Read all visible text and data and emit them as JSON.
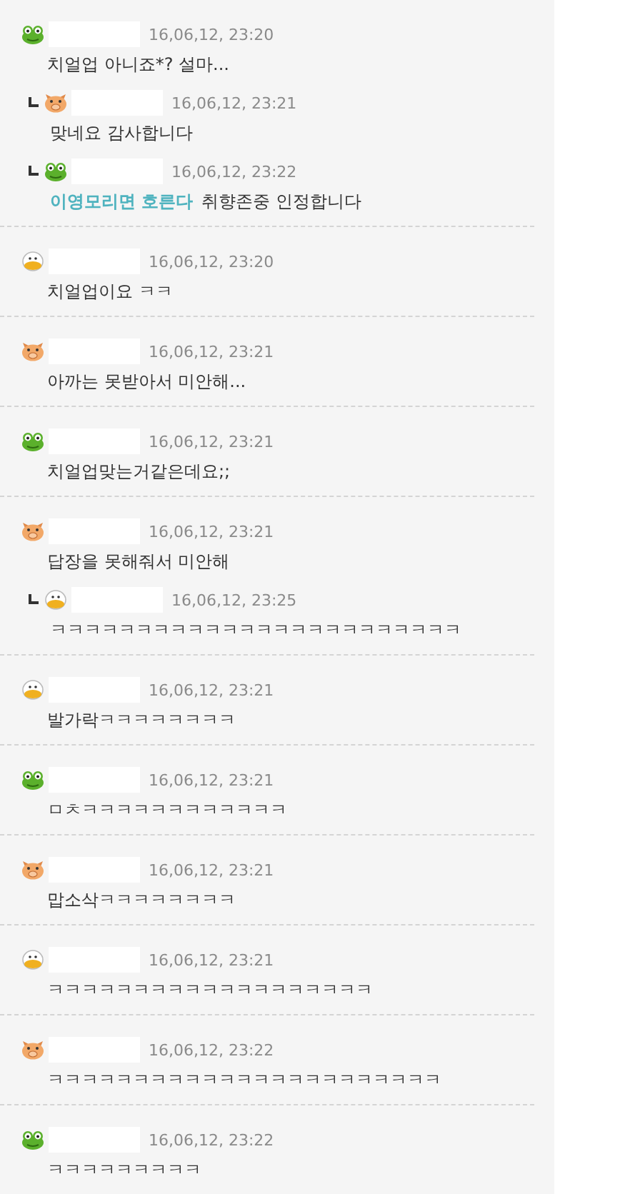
{
  "comments": [
    {
      "kind": "frog",
      "date": "16,06,12, 23:20",
      "text": "치얼업 아니죠*? 설마...",
      "replies": [
        {
          "kind": "pig",
          "date": "16,06,12, 23:21",
          "text": "맞네요 감사합니다"
        },
        {
          "kind": "frog",
          "date": "16,06,12, 23:22",
          "mention": "이영모리면 호른다",
          "text": "취향존중 인정합니다"
        }
      ]
    },
    {
      "kind": "duck",
      "date": "16,06,12, 23:20",
      "text": "치얼업이요 ㅋㅋ"
    },
    {
      "kind": "pig",
      "date": "16,06,12, 23:21",
      "text": "아까는 못받아서 미안해..."
    },
    {
      "kind": "frog",
      "date": "16,06,12, 23:21",
      "text": "치얼업맞는거같은데요;;"
    },
    {
      "kind": "pig",
      "date": "16,06,12, 23:21",
      "text": "답장을 못해줘서 미안해",
      "replies": [
        {
          "kind": "duck",
          "date": "16,06,12, 23:25",
          "text": "ㅋㅋㅋㅋㅋㅋㅋㅋㅋㅋㅋㅋㅋㅋㅋㅋㅋㅋㅋㅋㅋㅋㅋㅋ"
        }
      ]
    },
    {
      "kind": "duck",
      "date": "16,06,12, 23:21",
      "text": "발가락ㅋㅋㅋㅋㅋㅋㅋㅋ"
    },
    {
      "kind": "frog",
      "date": "16,06,12, 23:21",
      "text": "ㅁㅊㅋㅋㅋㅋㅋㅋㅋㅋㅋㅋㅋㅋ"
    },
    {
      "kind": "pig",
      "date": "16,06,12, 23:21",
      "text": "맙소삭ㅋㅋㅋㅋㅋㅋㅋㅋ"
    },
    {
      "kind": "duck",
      "date": "16,06,12, 23:21",
      "text": "ㅋㅋㅋㅋㅋㅋㅋㅋㅋㅋㅋㅋㅋㅋㅋㅋㅋㅋㅋ"
    },
    {
      "kind": "pig",
      "date": "16,06,12, 23:22",
      "text": "ㅋㅋㅋㅋㅋㅋㅋㅋㅋㅋㅋㅋㅋㅋㅋㅋㅋㅋㅋㅋㅋㅋㅋ"
    },
    {
      "kind": "frog",
      "date": "16,06,12, 23:22",
      "text": "ㅋㅋㅋㅋㅋㅋㅋㅋㅋ"
    }
  ]
}
